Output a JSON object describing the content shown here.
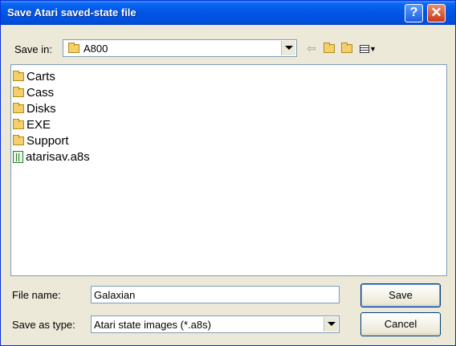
{
  "dialog": {
    "title": "Save Atari saved-state file",
    "help_glyph": "?",
    "close_glyph": "✕"
  },
  "save_in": {
    "label": "Save in:",
    "value": "A800"
  },
  "toolbar": {
    "icons": [
      "back-arrow-icon",
      "up-folder-icon",
      "new-folder-icon",
      "view-menu-icon"
    ]
  },
  "files": [
    {
      "name": "Carts",
      "type": "folder"
    },
    {
      "name": "Cass",
      "type": "folder"
    },
    {
      "name": "Disks",
      "type": "folder"
    },
    {
      "name": "EXE",
      "type": "folder"
    },
    {
      "name": "Support",
      "type": "folder"
    },
    {
      "name": "atarisav.a8s",
      "type": "file"
    }
  ],
  "file_name": {
    "label": "File name:",
    "value": "Galaxian"
  },
  "save_as_type": {
    "label": "Save as type:",
    "value": "Atari state images (*.a8s)"
  },
  "buttons": {
    "save": "Save",
    "cancel": "Cancel"
  }
}
